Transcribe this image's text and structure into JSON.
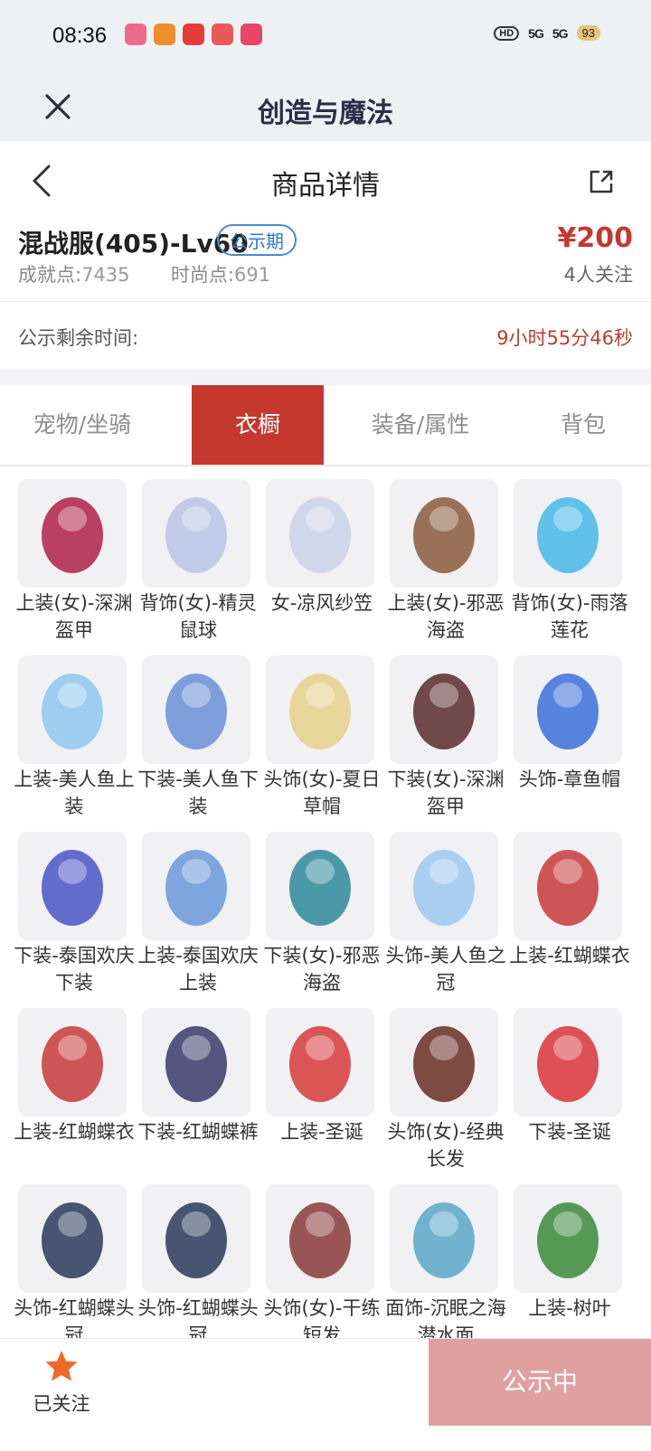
{
  "status_bar": {
    "time": "08:36",
    "hd_label": "HD",
    "signal1": "5G",
    "signal2": "5G",
    "battery": "93",
    "app_colors": [
      "#ee6a8b",
      "#f08d2c",
      "#e63b3b",
      "#e85a5a",
      "#e84666"
    ]
  },
  "app_bar": {
    "title": "创造与魔法",
    "close_icon": "close-icon"
  },
  "nav": {
    "title": "商品详情",
    "back_icon": "back-icon",
    "share_icon": "share-icon"
  },
  "product": {
    "name": "混战服(405)-Lv60",
    "badge": "公示期",
    "price": "¥200",
    "achievement_label": "成就点:",
    "achievement_value": "7435",
    "fashion_label": "时尚点:",
    "fashion_value": "691",
    "followers": "4人关注"
  },
  "timer": {
    "label": "公示剩余时间:",
    "value": "9小时55分46秒"
  },
  "tabs": [
    {
      "label": "宠物/坐骑",
      "active": false
    },
    {
      "label": "衣橱",
      "active": true
    },
    {
      "label": "装备/属性",
      "active": false
    },
    {
      "label": "背包",
      "active": false
    }
  ],
  "items": [
    {
      "label": "上装(女)-深渊盔甲",
      "color": "#b0204a"
    },
    {
      "label": "背饰(女)-精灵鼠球",
      "color": "#b8c4e6"
    },
    {
      "label": "女-凉风纱笠",
      "color": "#c9d4e6"
    },
    {
      "label": "上装(女)-邪恶海盗",
      "color": "#8a5a3a"
    },
    {
      "label": "背饰(女)-雨落莲花",
      "color": "#46b8e8"
    },
    {
      "label": "上装-美人鱼上装",
      "color": "#8ec8ee"
    },
    {
      "label": "下装-美人鱼下装",
      "color": "#6a8fd6"
    },
    {
      "label": "头饰(女)-夏日草帽",
      "color": "#e6d08a"
    },
    {
      "label": "下装(女)-深渊盔甲",
      "color": "#5a2c2c"
    },
    {
      "label": "头饰-章鱼帽",
      "color": "#3a70d8"
    },
    {
      "label": "下装-泰国欢庆下装",
      "color": "#4a54c6"
    },
    {
      "label": "上装-泰国欢庆上装",
      "color": "#6a98d8"
    },
    {
      "label": "下装(女)-邪恶海盗",
      "color": "#2e8a9a"
    },
    {
      "label": "头饰-美人鱼之冠",
      "color": "#9cc8ee"
    },
    {
      "label": "上装-红蝴蝶衣",
      "color": "#c83a3a"
    },
    {
      "label": "上装-红蝴蝶衣",
      "color": "#c83a3a"
    },
    {
      "label": "下装-红蝴蝶裤",
      "color": "#3a3a6a"
    },
    {
      "label": "上装-圣诞",
      "color": "#d83a3a"
    },
    {
      "label": "头饰(女)-经典长发",
      "color": "#6a2e22"
    },
    {
      "label": "下装-圣诞",
      "color": "#d8343a"
    },
    {
      "label": "头饰-红蝴蝶头冠",
      "color": "#2a3a5a"
    },
    {
      "label": "头饰-红蝴蝶头冠",
      "color": "#2a3a5a"
    },
    {
      "label": "头饰(女)-干练短发",
      "color": "#8a3a3a"
    },
    {
      "label": "面饰-沉眠之海潜水面",
      "color": "#5aa8c8"
    },
    {
      "label": "上装-树叶",
      "color": "#3a8a3a"
    }
  ],
  "bottom": {
    "follow_label": "已关注",
    "cta_label": "公示中"
  }
}
